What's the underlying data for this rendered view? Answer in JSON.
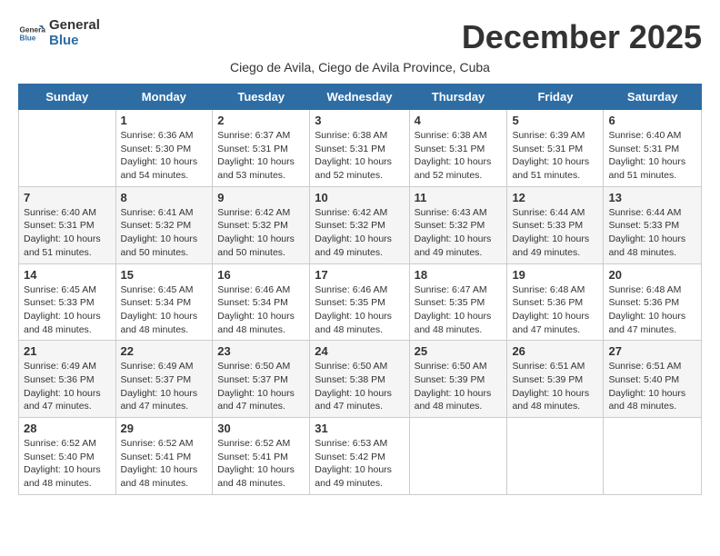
{
  "header": {
    "logo_general": "General",
    "logo_blue": "Blue",
    "title": "December 2025",
    "subtitle": "Ciego de Avila, Ciego de Avila Province, Cuba"
  },
  "weekdays": [
    "Sunday",
    "Monday",
    "Tuesday",
    "Wednesday",
    "Thursday",
    "Friday",
    "Saturday"
  ],
  "weeks": [
    [
      {
        "day": "",
        "info": ""
      },
      {
        "day": "1",
        "info": "Sunrise: 6:36 AM\nSunset: 5:30 PM\nDaylight: 10 hours\nand 54 minutes."
      },
      {
        "day": "2",
        "info": "Sunrise: 6:37 AM\nSunset: 5:31 PM\nDaylight: 10 hours\nand 53 minutes."
      },
      {
        "day": "3",
        "info": "Sunrise: 6:38 AM\nSunset: 5:31 PM\nDaylight: 10 hours\nand 52 minutes."
      },
      {
        "day": "4",
        "info": "Sunrise: 6:38 AM\nSunset: 5:31 PM\nDaylight: 10 hours\nand 52 minutes."
      },
      {
        "day": "5",
        "info": "Sunrise: 6:39 AM\nSunset: 5:31 PM\nDaylight: 10 hours\nand 51 minutes."
      },
      {
        "day": "6",
        "info": "Sunrise: 6:40 AM\nSunset: 5:31 PM\nDaylight: 10 hours\nand 51 minutes."
      }
    ],
    [
      {
        "day": "7",
        "info": "Sunrise: 6:40 AM\nSunset: 5:31 PM\nDaylight: 10 hours\nand 51 minutes."
      },
      {
        "day": "8",
        "info": "Sunrise: 6:41 AM\nSunset: 5:32 PM\nDaylight: 10 hours\nand 50 minutes."
      },
      {
        "day": "9",
        "info": "Sunrise: 6:42 AM\nSunset: 5:32 PM\nDaylight: 10 hours\nand 50 minutes."
      },
      {
        "day": "10",
        "info": "Sunrise: 6:42 AM\nSunset: 5:32 PM\nDaylight: 10 hours\nand 49 minutes."
      },
      {
        "day": "11",
        "info": "Sunrise: 6:43 AM\nSunset: 5:32 PM\nDaylight: 10 hours\nand 49 minutes."
      },
      {
        "day": "12",
        "info": "Sunrise: 6:44 AM\nSunset: 5:33 PM\nDaylight: 10 hours\nand 49 minutes."
      },
      {
        "day": "13",
        "info": "Sunrise: 6:44 AM\nSunset: 5:33 PM\nDaylight: 10 hours\nand 48 minutes."
      }
    ],
    [
      {
        "day": "14",
        "info": "Sunrise: 6:45 AM\nSunset: 5:33 PM\nDaylight: 10 hours\nand 48 minutes."
      },
      {
        "day": "15",
        "info": "Sunrise: 6:45 AM\nSunset: 5:34 PM\nDaylight: 10 hours\nand 48 minutes."
      },
      {
        "day": "16",
        "info": "Sunrise: 6:46 AM\nSunset: 5:34 PM\nDaylight: 10 hours\nand 48 minutes."
      },
      {
        "day": "17",
        "info": "Sunrise: 6:46 AM\nSunset: 5:35 PM\nDaylight: 10 hours\nand 48 minutes."
      },
      {
        "day": "18",
        "info": "Sunrise: 6:47 AM\nSunset: 5:35 PM\nDaylight: 10 hours\nand 48 minutes."
      },
      {
        "day": "19",
        "info": "Sunrise: 6:48 AM\nSunset: 5:36 PM\nDaylight: 10 hours\nand 47 minutes."
      },
      {
        "day": "20",
        "info": "Sunrise: 6:48 AM\nSunset: 5:36 PM\nDaylight: 10 hours\nand 47 minutes."
      }
    ],
    [
      {
        "day": "21",
        "info": "Sunrise: 6:49 AM\nSunset: 5:36 PM\nDaylight: 10 hours\nand 47 minutes."
      },
      {
        "day": "22",
        "info": "Sunrise: 6:49 AM\nSunset: 5:37 PM\nDaylight: 10 hours\nand 47 minutes."
      },
      {
        "day": "23",
        "info": "Sunrise: 6:50 AM\nSunset: 5:37 PM\nDaylight: 10 hours\nand 47 minutes."
      },
      {
        "day": "24",
        "info": "Sunrise: 6:50 AM\nSunset: 5:38 PM\nDaylight: 10 hours\nand 47 minutes."
      },
      {
        "day": "25",
        "info": "Sunrise: 6:50 AM\nSunset: 5:39 PM\nDaylight: 10 hours\nand 48 minutes."
      },
      {
        "day": "26",
        "info": "Sunrise: 6:51 AM\nSunset: 5:39 PM\nDaylight: 10 hours\nand 48 minutes."
      },
      {
        "day": "27",
        "info": "Sunrise: 6:51 AM\nSunset: 5:40 PM\nDaylight: 10 hours\nand 48 minutes."
      }
    ],
    [
      {
        "day": "28",
        "info": "Sunrise: 6:52 AM\nSunset: 5:40 PM\nDaylight: 10 hours\nand 48 minutes."
      },
      {
        "day": "29",
        "info": "Sunrise: 6:52 AM\nSunset: 5:41 PM\nDaylight: 10 hours\nand 48 minutes."
      },
      {
        "day": "30",
        "info": "Sunrise: 6:52 AM\nSunset: 5:41 PM\nDaylight: 10 hours\nand 48 minutes."
      },
      {
        "day": "31",
        "info": "Sunrise: 6:53 AM\nSunset: 5:42 PM\nDaylight: 10 hours\nand 49 minutes."
      },
      {
        "day": "",
        "info": ""
      },
      {
        "day": "",
        "info": ""
      },
      {
        "day": "",
        "info": ""
      }
    ]
  ]
}
